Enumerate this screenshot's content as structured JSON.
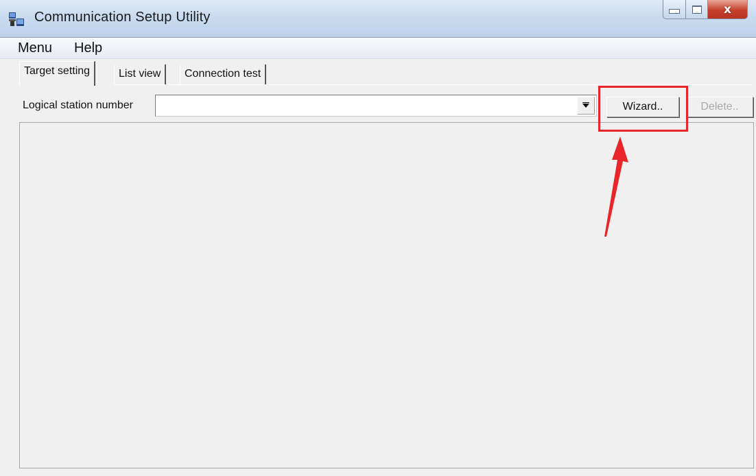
{
  "window": {
    "title": "Communication Setup Utility",
    "icons": {
      "app": "app-icon",
      "minimize": "minimize-icon",
      "maximize": "maximize-icon",
      "close": "close-icon"
    },
    "close_glyph": "x"
  },
  "menubar": {
    "items": [
      {
        "label": "Menu"
      },
      {
        "label": "Help"
      }
    ]
  },
  "tabs": [
    {
      "label": "Target setting",
      "active": true
    },
    {
      "label": "List view",
      "active": false
    },
    {
      "label": "Connection test",
      "active": false
    }
  ],
  "station": {
    "label": "Logical station number",
    "value": "",
    "dropdown_icon": "chevron-down-icon"
  },
  "buttons": {
    "wizard": {
      "label": "Wizard..",
      "enabled": true
    },
    "delete": {
      "label": "Delete..",
      "enabled": false
    }
  },
  "annotation": {
    "color": "#e8262a",
    "target": "wizard-button",
    "icons": [
      "highlight-box",
      "arrow-icon"
    ]
  },
  "colors": {
    "background": "#f0f0f0",
    "titlebar": "#c9dbef",
    "close_button": "#c6422e",
    "disabled_text": "#a8a8a8"
  }
}
